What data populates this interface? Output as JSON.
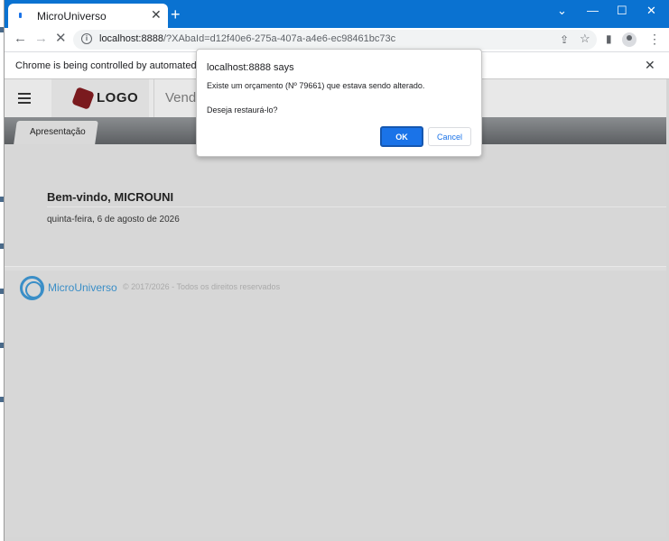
{
  "browser": {
    "tab_title": "MicroUniverso",
    "tab_close": "✕",
    "new_tab": "+",
    "window_controls": {
      "menu": "⌄",
      "minimize": "—",
      "maximize": "☐",
      "close": "✕"
    },
    "nav": {
      "back": "←",
      "forward": "→",
      "reload": "✕"
    },
    "address": {
      "host": "localhost:8888",
      "path": "/?XAbaId=d12f40e6-275a-407a-a4e6-ec98461bc73c"
    },
    "toolbar_icons": {
      "share": "⇪",
      "star": "☆",
      "sidepanel": "▮",
      "menu": "⋮"
    },
    "infobar_text": "Chrome is being controlled by automated test so",
    "infobar_close": "✕"
  },
  "app": {
    "logo_text": "LOGO",
    "header_nav": "Vend",
    "menu_tab": "Apresentação",
    "welcome": "Bem-vindo, MICROUNI",
    "date": "quinta-feira, 6 de agosto de 2026",
    "footer_brand": "MicroUniverso",
    "copyright": "© 2017/2026 - Todos os direitos reservados"
  },
  "dialog": {
    "title": "localhost:8888 says",
    "message_line1": "Existe um orçamento (Nº 79661) que estava sendo alterado.",
    "message_line2": "Deseja restaurá-lo?",
    "ok_label": "OK",
    "cancel_label": "Cancel"
  },
  "colors": {
    "chrome_blue": "#0a72d1",
    "accent": "#1a73e8",
    "brand_red": "#7a1a1e",
    "brand_blue": "#3a8ec7"
  }
}
